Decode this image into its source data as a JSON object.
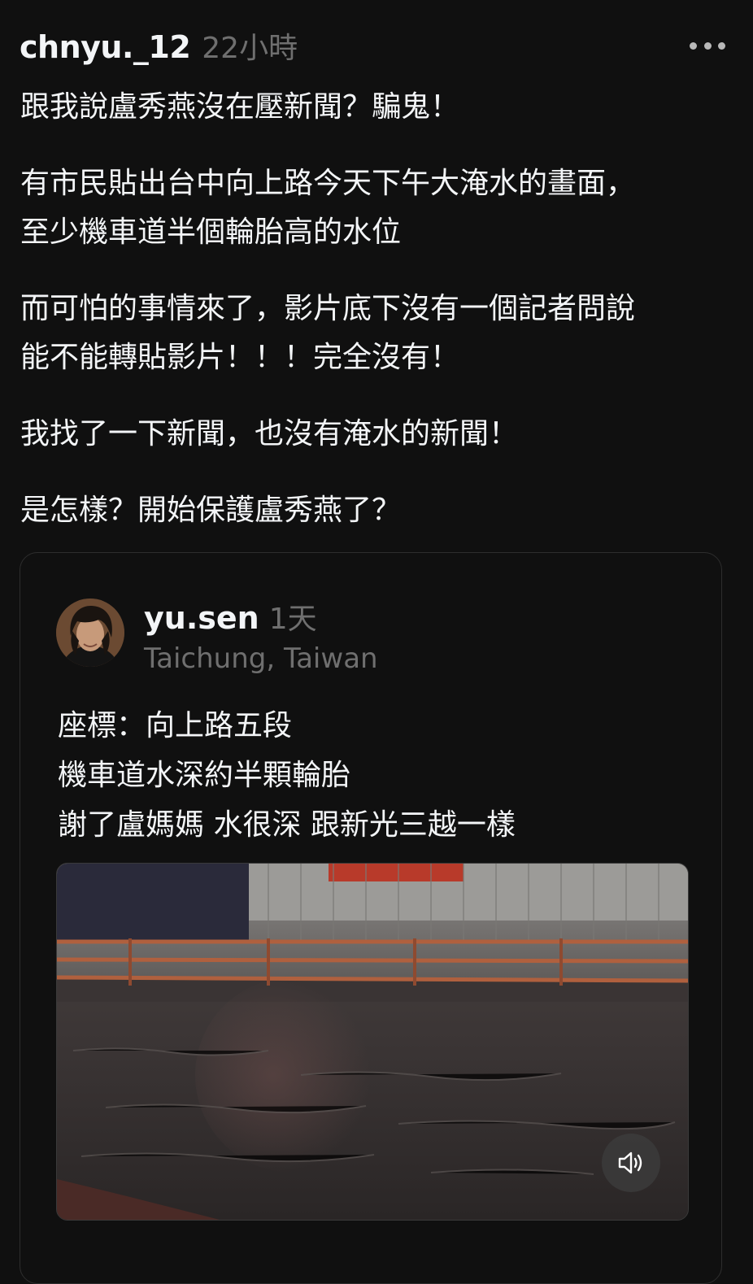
{
  "post": {
    "username": "chnyu._12",
    "timestamp": "22小時",
    "more_icon": "more-horizontal-icon",
    "paragraphs": [
      "跟我說盧秀燕沒在壓新聞？騙鬼！",
      "有市民貼出台中向上路今天下午大淹水的畫面，\n至少機車道半個輪胎高的水位",
      "而可怕的事情來了，影片底下沒有一個記者問說\n能不能轉貼影片！！！完全沒有！",
      "我找了一下新聞，也沒有淹水的新聞！",
      "是怎樣？開始保護盧秀燕了？"
    ]
  },
  "quoted_post": {
    "username": "yu.sen",
    "timestamp": "1天",
    "location": "Taichung, Taiwan",
    "lines": [
      "座標：向上路五段",
      "機車道水深約半顆輪胎",
      "謝了盧媽媽 水很深 跟新光三越一樣"
    ],
    "video": {
      "sound_icon": "speaker-icon"
    }
  },
  "colors": {
    "background": "#101010",
    "text_primary": "#f3f5f7",
    "text_secondary": "#6f6f6f",
    "card_border": "#2e2e2e"
  }
}
